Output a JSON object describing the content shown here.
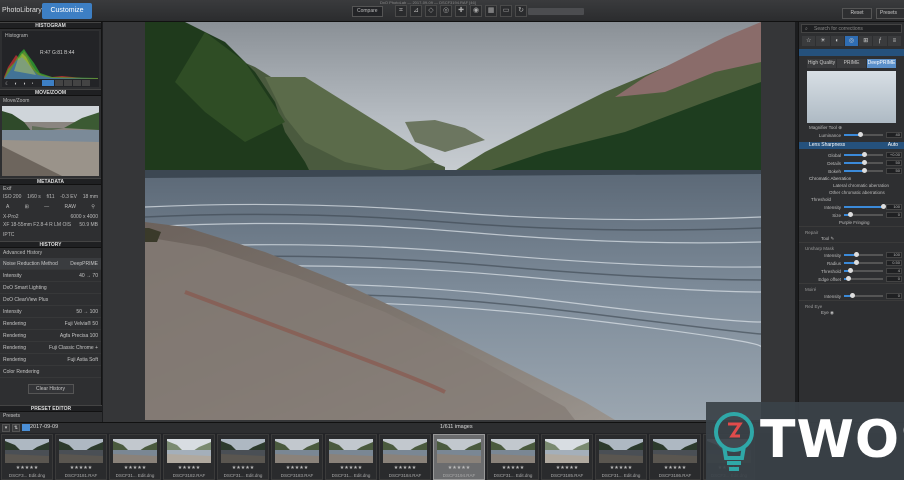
{
  "topbar": {
    "app_title": "PhotoLibrary",
    "customize_tab": "Customize",
    "compare_label": "Compare",
    "window_title": "DxO PhotoLab — 2017-09-09 — DSCF3194.RAF [46]",
    "reset_label": "Reset",
    "presets_label": "Presets"
  },
  "left_panel": {
    "histogram": {
      "title": "HISTOGRAM",
      "label": "Histogram",
      "rgb_readout": "R:47 G:81 B:44"
    },
    "move_zoom": {
      "title": "MOVE/ZOOM",
      "label": "Move/Zoom"
    },
    "metadata": {
      "title": "METADATA",
      "exif_label": "Exif",
      "row1": [
        "ISO 200",
        "1/60 s",
        "f/11",
        "-0.3 EV",
        "18 mm"
      ],
      "row2_labels": [
        "RAW"
      ],
      "camera": "X-Pro2",
      "dimensions": "6000 x 4000",
      "lens": "XF 18-55mm F2.8-4 R LM OIS",
      "filesize": "50.9 MB",
      "iptc_label": "IPTC"
    },
    "history": {
      "title": "HISTORY",
      "subtitle": "Advanced History",
      "items": [
        {
          "name": "Noise Reduction Method",
          "value": "DeepPRIME",
          "selected": true
        },
        {
          "name": "Intensity",
          "value": "40 → 70",
          "selected": false
        },
        {
          "name": "DxO Smart Lighting",
          "value": "",
          "selected": false
        },
        {
          "name": "DxO ClearView Plus",
          "value": "",
          "selected": false
        },
        {
          "name": "Intensity",
          "value": "50 → 100",
          "selected": false
        },
        {
          "name": "Rendering",
          "value": "Fuji Velvia® 50",
          "selected": false
        },
        {
          "name": "Rendering",
          "value": "Agfa Precisa 100",
          "selected": false
        },
        {
          "name": "Rendering",
          "value": "Fuji Classic Chrome +",
          "selected": false
        },
        {
          "name": "Rendering",
          "value": "Fuji Astia Soft",
          "selected": false
        },
        {
          "name": "Color Rendering",
          "value": "",
          "selected": false
        }
      ],
      "clear_label": "Clear History"
    },
    "preset_editor": {
      "title": "PRESET EDITOR",
      "label": "Presets"
    }
  },
  "right_panel": {
    "search_placeholder": "Search for corrections",
    "noise": {
      "tabs": [
        "High Quality",
        "PRIME",
        "DeepPRIME"
      ],
      "magnifier_label": "Magnifier Tool",
      "luminance_label": "Luminance",
      "luminance_value": "40"
    },
    "lens_sharpness": {
      "title": "Lens Sharpness",
      "auto_label": "Auto",
      "sliders": [
        {
          "name": "Global",
          "value": "+0.00",
          "pct": 0.5
        },
        {
          "name": "Details",
          "value": "50",
          "pct": 0.5
        },
        {
          "name": "Bokeh",
          "value": "50",
          "pct": 0.5
        }
      ]
    },
    "chromatic": {
      "title": "Chromatic Aberration",
      "lateral_label": "Lateral chromatic aberration",
      "other_label": "Other chromatic aberrations",
      "threshold_label": "Threshold",
      "intensity_label": "Intensity",
      "intensity_value": "100",
      "intensity_pct": 1.0,
      "size_label": "Size",
      "size_value": "0",
      "size_pct": 0.15,
      "purple_label": "Purple Fringing"
    },
    "repair": {
      "title": "Repair",
      "tool_label": "Tool"
    },
    "unsharp": {
      "title": "Unsharp Mask",
      "sliders": [
        {
          "name": "Intensity",
          "value": "100",
          "pct": 0.3
        },
        {
          "name": "Radius",
          "value": "0.50",
          "pct": 0.3
        },
        {
          "name": "Threshold",
          "value": "4",
          "pct": 0.15
        },
        {
          "name": "Edge offset",
          "value": "0",
          "pct": 0.1
        }
      ]
    },
    "moire": {
      "title": "Moiré",
      "intensity_label": "Intensity",
      "intensity_value": "0",
      "pct": 0.2
    },
    "redeye": {
      "title": "Red Eye",
      "eye_label": "Eye"
    }
  },
  "bottom": {
    "date": "2017-09-09",
    "count": "1/611 images",
    "thumbs": [
      {
        "name": "DSCF3... Edit.dng",
        "stars": "★★★★★",
        "tone": "dark",
        "selected": false
      },
      {
        "name": "DSCF3181.RAF",
        "stars": "★★★★★",
        "tone": "dark",
        "selected": false
      },
      {
        "name": "DSCF31... Edit.dng",
        "stars": "★★★★★",
        "tone": "mid",
        "selected": false
      },
      {
        "name": "DSCF3182.RAF",
        "stars": "★★★★★",
        "tone": "light",
        "selected": false
      },
      {
        "name": "DSCF31... Edit.dng",
        "stars": "★★★★★",
        "tone": "dark",
        "selected": false
      },
      {
        "name": "DSCF3183.RAF",
        "stars": "★★★★★",
        "tone": "mid",
        "selected": false
      },
      {
        "name": "DSCF31... Edit.dng",
        "stars": "★★★★★",
        "tone": "mid",
        "selected": false
      },
      {
        "name": "DSCF3184.RAF",
        "stars": "★★★★★",
        "tone": "mid",
        "selected": false
      },
      {
        "name": "DSCF3194.RAF",
        "stars": "★★★★★",
        "tone": "mid",
        "selected": true
      },
      {
        "name": "DSCF31... Edit.dng",
        "stars": "★★★★★",
        "tone": "mid",
        "selected": false
      },
      {
        "name": "DSCF3185.RAF",
        "stars": "★★★★★",
        "tone": "light",
        "selected": false
      },
      {
        "name": "DSCF31... Edit.dng",
        "stars": "★★★★★",
        "tone": "dark",
        "selected": false
      },
      {
        "name": "DSCF3186.RAF",
        "stars": "★★★★★",
        "tone": "dark",
        "selected": false
      },
      {
        "name": "DSCF3... Edit.dng",
        "stars": "★★★★★",
        "tone": "dark",
        "selected": false
      }
    ]
  },
  "watermark": {
    "text": "TWOS"
  },
  "colors": {
    "accent": "#3d7fc4",
    "panel": "#2e2f31",
    "watermark_bg": "#3a4248",
    "watermark_logo": "#2fa8a8"
  }
}
